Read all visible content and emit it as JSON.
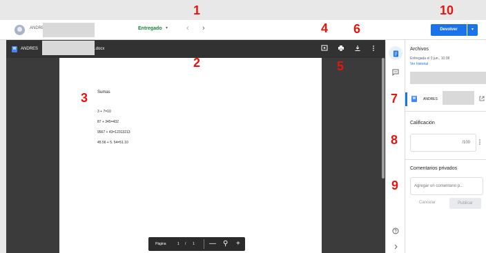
{
  "markers": [
    "1",
    "2",
    "3",
    "4",
    "5",
    "6",
    "7",
    "8",
    "9",
    "10"
  ],
  "header": {
    "student_name": "ANDRES",
    "status": "Entregado",
    "status_caret": "▾",
    "prev": "‹",
    "next": "›",
    "return_label": "Devolver",
    "return_caret": "▾"
  },
  "viewer": {
    "file_name": "ANDRES",
    "file_ext": ".docx",
    "doc_icon": "W",
    "icons": [
      "add-comment-icon",
      "print-icon",
      "download-icon",
      "more-vert-icon"
    ]
  },
  "document": {
    "title": "Sumas",
    "lines": [
      "3 + 7=10",
      "87 + 345=432",
      "9567 + 43=12313213",
      "45.56 + 5. 54=51.10"
    ]
  },
  "pager": {
    "label": "Página",
    "current": "1",
    "separator": "/",
    "total": "1",
    "zoom_out": "—",
    "zoom_icon": "⚲",
    "zoom_in": "+"
  },
  "rail": {
    "icons": [
      "files-icon",
      "comments-icon",
      "help-icon",
      "expand-icon"
    ]
  },
  "panel": {
    "files_heading": "Archivos",
    "submitted_text": "Entregada el 3 jun., 10:38",
    "history_link": "Ver historial",
    "attachment_name": "ANDRES",
    "grade_heading": "Calificación",
    "grade_denominator": "/100",
    "private_comments_heading": "Comentarios privados",
    "comment_placeholder": "Agregar un comentario p...",
    "cancel_label": "Cancelar",
    "publish_label": "Publicar"
  },
  "colors": {
    "accent": "#1a73e8",
    "status": "#188038",
    "marker": "#e8140c"
  }
}
